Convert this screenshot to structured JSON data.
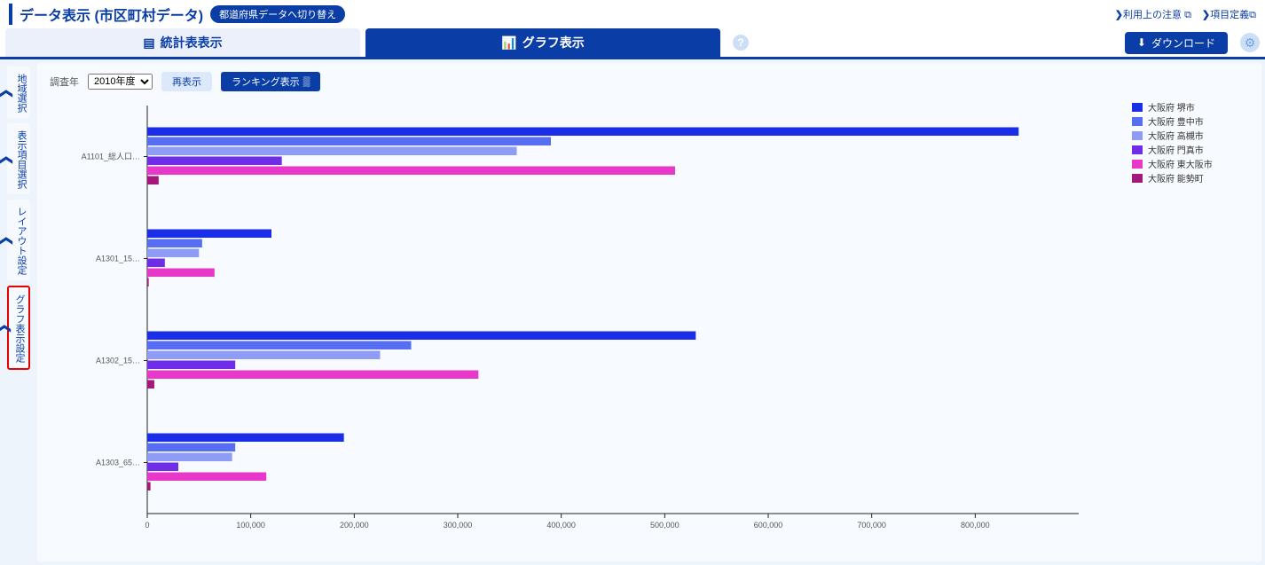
{
  "header": {
    "title": "データ表示 (市区町村データ)",
    "switch_pill": "都道府県データへ切り替え",
    "link_usage": "利用上の注意",
    "link_def": "項目定義"
  },
  "tabs": {
    "table_label": "統計表表示",
    "graph_label": "グラフ表示",
    "download_label": "ダウンロード"
  },
  "side": {
    "region": "地域選択",
    "items": "表示項目選択",
    "layout": "レイアウト設定",
    "graph": "グラフ表示設定"
  },
  "controls": {
    "year_label": "調査年",
    "year_value": "2010年度",
    "redisplay": "再表示",
    "ranking": "ランキング表示"
  },
  "chart_data": {
    "type": "bar",
    "orientation": "horizontal",
    "grouped": true,
    "xlabel": "",
    "ylabel": "",
    "xlim": [
      0,
      900000
    ],
    "xticks": [
      0,
      100000,
      200000,
      300000,
      400000,
      500000,
      600000,
      700000,
      800000
    ],
    "categories": [
      "A1101_総人口…",
      "A1301_15…",
      "A1302_15…",
      "A1303_65…"
    ],
    "series": [
      {
        "name": "大阪府 堺市",
        "color": "#1a2ee8",
        "values": [
          842000,
          120000,
          530000,
          190000
        ]
      },
      {
        "name": "大阪府 豊中市",
        "color": "#576df2",
        "values": [
          390000,
          53000,
          255000,
          85000
        ]
      },
      {
        "name": "大阪府 高槻市",
        "color": "#8e9cf5",
        "values": [
          357000,
          50000,
          225000,
          82000
        ]
      },
      {
        "name": "大阪府 門真市",
        "color": "#6f2de8",
        "values": [
          130000,
          17000,
          85000,
          30000
        ]
      },
      {
        "name": "大阪府 東大阪市",
        "color": "#e838c9",
        "values": [
          510000,
          65000,
          320000,
          115000
        ]
      },
      {
        "name": "大阪府 能勢町",
        "color": "#a31879",
        "values": [
          11000,
          1400,
          6800,
          3100
        ]
      }
    ]
  }
}
